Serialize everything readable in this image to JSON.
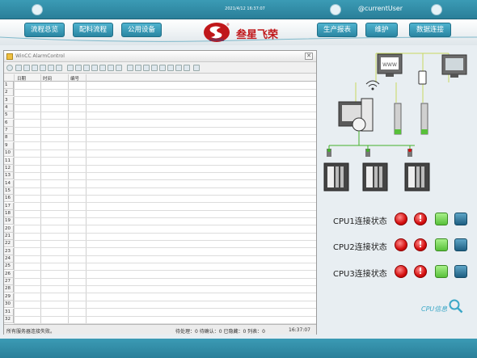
{
  "topbar": {
    "datetime": "2021/4/12 16:37:07",
    "username": "@currentUser"
  },
  "nav": {
    "left": [
      "流程总览",
      "配料流程",
      "公用设备"
    ],
    "right": [
      "生产报表",
      "维护",
      "数据连接"
    ]
  },
  "brand": {
    "name": "叁星飞荣",
    "logo_text": "SANXING",
    "registered": "®"
  },
  "alarm_window": {
    "title": "WinCC AlarmControl",
    "close": "✕",
    "columns": [
      "日期",
      "时间",
      "编号"
    ],
    "rows": [
      "1",
      "2",
      "3",
      "4",
      "5",
      "6",
      "7",
      "8",
      "9",
      "10",
      "11",
      "12",
      "13",
      "14",
      "15",
      "16",
      "17",
      "18",
      "19",
      "20",
      "21",
      "22",
      "23",
      "24",
      "25",
      "26",
      "27",
      "28",
      "29",
      "30",
      "31",
      "32"
    ],
    "status_left": "所有服务器连接失败。",
    "status_counts": "待处理：0  待确认：0  已隐藏：0  列表：0",
    "status_time": "16:37:07"
  },
  "cpu_status": [
    {
      "label": "CPU1连接状态"
    },
    {
      "label": "CPU2连接状态"
    },
    {
      "label": "CPU3连接状态"
    }
  ],
  "cpu_info_label": "CPU信息",
  "colors": {
    "accent": "#2a86a2",
    "alarm_red": "#d40f0f",
    "ok_green": "#58c03a",
    "dark_blue": "#1e5e82",
    "brand_red": "#c0171a"
  }
}
